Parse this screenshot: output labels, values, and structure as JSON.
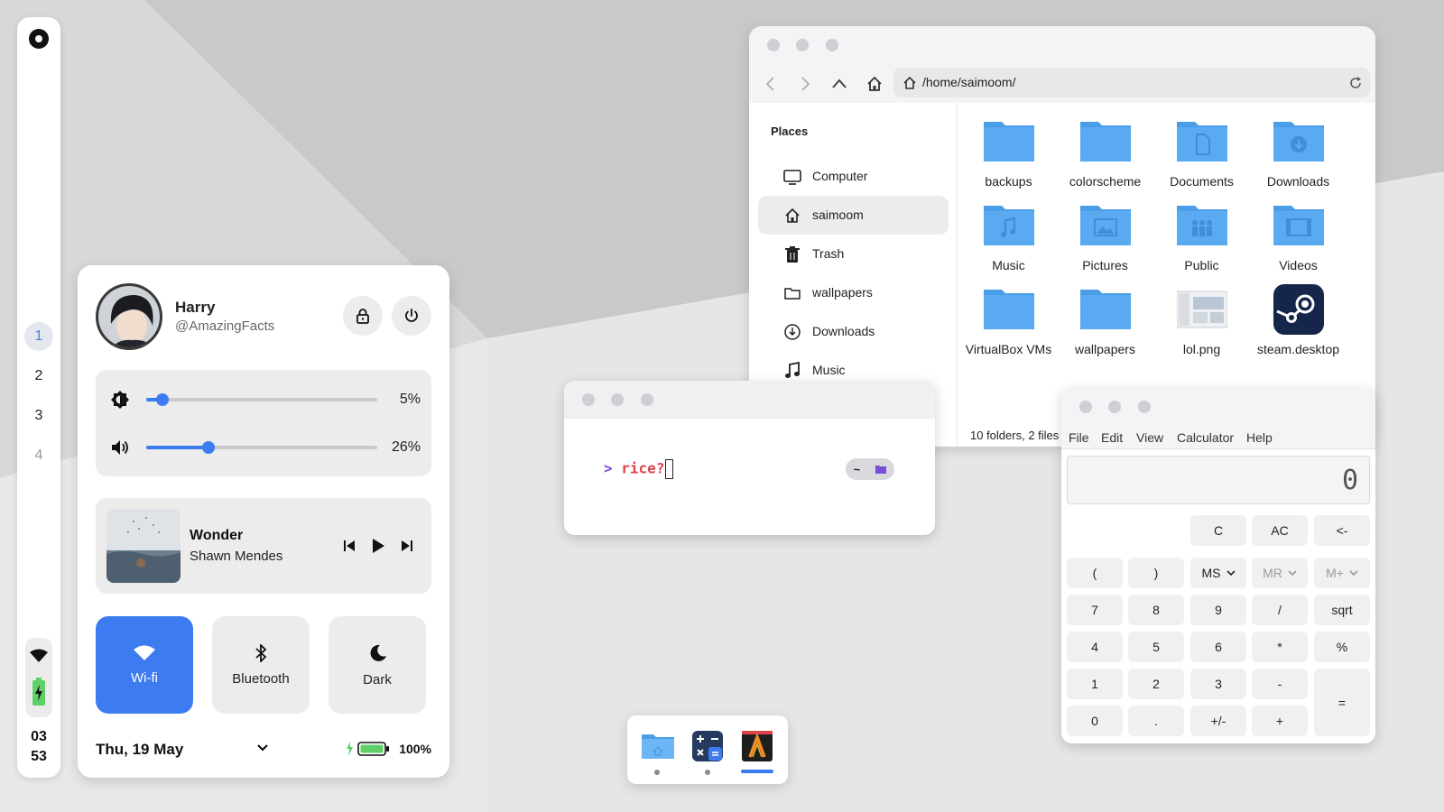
{
  "colors": {
    "accent": "#3d7cf0",
    "folder": "#5aaaf2",
    "prompt_arrow": "#7c4ddb",
    "prompt_cmd": "#e0434a",
    "battery_green": "#5fd068"
  },
  "sidebar": {
    "workspaces": [
      "1",
      "2",
      "3",
      "4"
    ],
    "active_workspace": "1",
    "clock_hour": "03",
    "clock_minute": "53"
  },
  "control_center": {
    "user_name": "Harry",
    "user_handle": "@AmazingFacts",
    "brightness_value": "5%",
    "brightness_level": 0.07,
    "volume_value": "26%",
    "volume_level": 0.27,
    "media": {
      "title": "Wonder",
      "artist": "Shawn Mendes"
    },
    "tiles": {
      "wifi": "Wi-fi",
      "bluetooth": "Bluetooth",
      "dark": "Dark"
    },
    "date": "Thu, 19 May",
    "battery": "100%",
    "icons": [
      "lock-icon",
      "power-icon",
      "brightness-icon",
      "volume-icon",
      "previous-icon",
      "play-icon",
      "next-icon",
      "wifi-icon",
      "bluetooth-icon",
      "moon-icon",
      "chevron-down-icon",
      "battery-icon"
    ]
  },
  "file_manager": {
    "path": "/home/saimoom/",
    "places_title": "Places",
    "places": [
      "Computer",
      "saimoom",
      "Trash",
      "wallpapers",
      "Downloads",
      "Music"
    ],
    "active_place": "saimoom",
    "files": [
      "backups",
      "colorscheme",
      "Documents",
      "Downloads",
      "Music",
      "Pictures",
      "Public",
      "Videos",
      "VirtualBox VMs",
      "wallpapers",
      "lol.png",
      "steam.desktop"
    ],
    "status": "10 folders, 2 files"
  },
  "terminal": {
    "prompt_symbol": ">",
    "command": "rice?",
    "rprompt_dir": "~"
  },
  "calculator": {
    "menu": [
      "File",
      "Edit",
      "View",
      "Calculator",
      "Help"
    ],
    "display": "0",
    "keys": {
      "c": "C",
      "ac": "AC",
      "back": "<-",
      "lparen": "(",
      "rparen": ")",
      "ms": "MS",
      "mr": "MR",
      "mplus": "M+",
      "k7": "7",
      "k8": "8",
      "k9": "9",
      "div": "/",
      "sqrt": "sqrt",
      "k4": "4",
      "k5": "5",
      "k6": "6",
      "mul": "*",
      "pct": "%",
      "k1": "1",
      "k2": "2",
      "k3": "3",
      "minus": "-",
      "eq": "=",
      "k0": "0",
      "dot": ".",
      "neg": "+/-",
      "plus": "+"
    }
  },
  "dock": {
    "apps": [
      "files-icon",
      "calculator-icon",
      "terminal-icon"
    ],
    "active_app": "terminal-icon"
  }
}
